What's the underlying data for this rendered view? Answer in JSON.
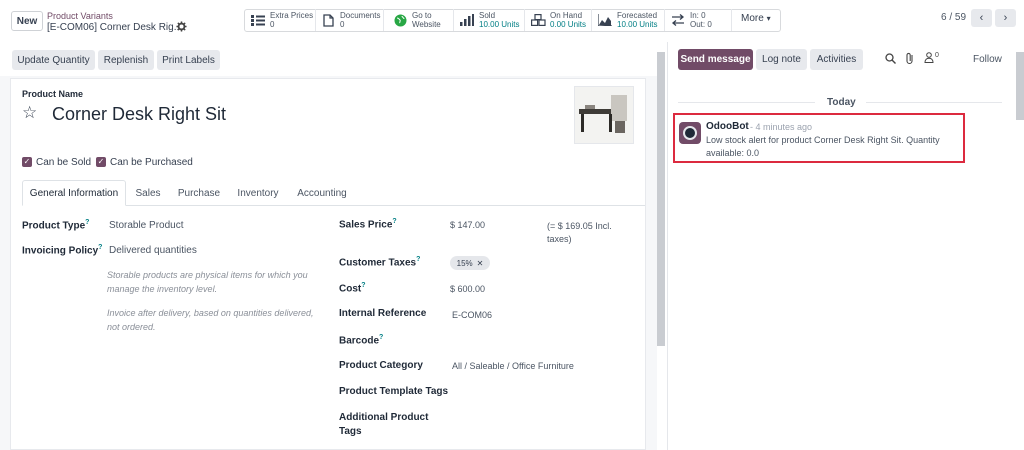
{
  "topbar": {
    "new_label": "New",
    "breadcrumb_parent": "Product Variants",
    "breadcrumb_current": "[E-COM06] Corner Desk Rig...",
    "pager": "6 / 59",
    "more_label": "More",
    "smart_buttons": [
      {
        "label": "Extra Prices",
        "value": "0"
      },
      {
        "label": "Documents",
        "value": "0"
      },
      {
        "label": "Go to",
        "value": "Website"
      },
      {
        "label": "Sold",
        "value": "10.00 Units"
      },
      {
        "label": "On Hand",
        "value": "0.00 Units"
      },
      {
        "label": "Forecasted",
        "value": "10.00 Units"
      },
      {
        "label": "In: 0",
        "value": "Out: 0"
      }
    ]
  },
  "actions": {
    "update_quantity": "Update Quantity",
    "replenish": "Replenish",
    "print_labels": "Print Labels"
  },
  "form": {
    "name_label": "Product Name",
    "name": "Corner Desk Right Sit",
    "can_be_sold": "Can be Sold",
    "can_be_purchased": "Can be Purchased",
    "tabs": [
      "General Information",
      "Sales",
      "Purchase",
      "Inventory",
      "Accounting"
    ],
    "product_type_label": "Product Type",
    "product_type": "Storable Product",
    "invoicing_policy_label": "Invoicing Policy",
    "invoicing_policy": "Delivered quantities",
    "help_storable": "Storable products are physical items for which you manage the inventory level.",
    "help_invoice": "Invoice after delivery, based on quantities delivered, not ordered.",
    "sales_price_label": "Sales Price",
    "sales_price": "$ 147.00",
    "sales_price_incl": "(= $ 169.05 Incl. taxes)",
    "customer_taxes_label": "Customer Taxes",
    "customer_taxes_tag": "15%",
    "cost_label": "Cost",
    "cost": "$ 600.00",
    "internal_ref_label": "Internal Reference",
    "internal_ref": "E-COM06",
    "barcode_label": "Barcode",
    "category_label": "Product Category",
    "category": "All / Saleable / Office Furniture",
    "template_tags_label": "Product Template Tags",
    "additional_tags_label": "Additional Product Tags"
  },
  "chatter": {
    "send_message": "Send message",
    "log_note": "Log note",
    "activities": "Activities",
    "followers_count": "0",
    "follow": "Follow",
    "today": "Today",
    "author": "OdooBot",
    "time": "- 4 minutes ago",
    "body": "Low stock alert for product Corner Desk Right Sit. Quantity available: 0.0"
  },
  "colors": {
    "brand": "#714b67",
    "highlight": "#dc2a3f",
    "accent_teal": "#017e84"
  }
}
